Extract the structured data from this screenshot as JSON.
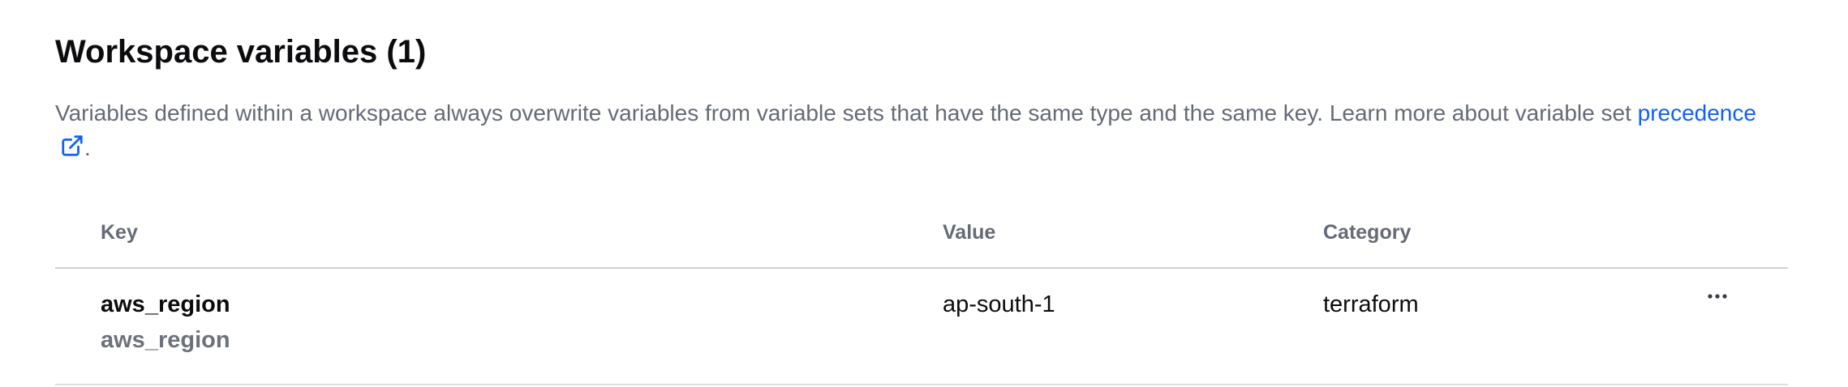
{
  "section": {
    "title": "Workspace variables (1)",
    "description": "Variables defined within a workspace always overwrite variables from variable sets that have the same type and the same key. Learn more about variable set ",
    "link_label": "precedence",
    "link_suffix": ".",
    "link_icon": "external-link-icon",
    "link_color": "#1060ff"
  },
  "table": {
    "headers": {
      "key": "Key",
      "value": "Value",
      "category": "Category"
    },
    "rows": [
      {
        "key": "aws_region",
        "key_description": "aws_region",
        "value": "ap-south-1",
        "category": "terraform",
        "actions_icon": "more-horizontal-icon"
      }
    ]
  }
}
